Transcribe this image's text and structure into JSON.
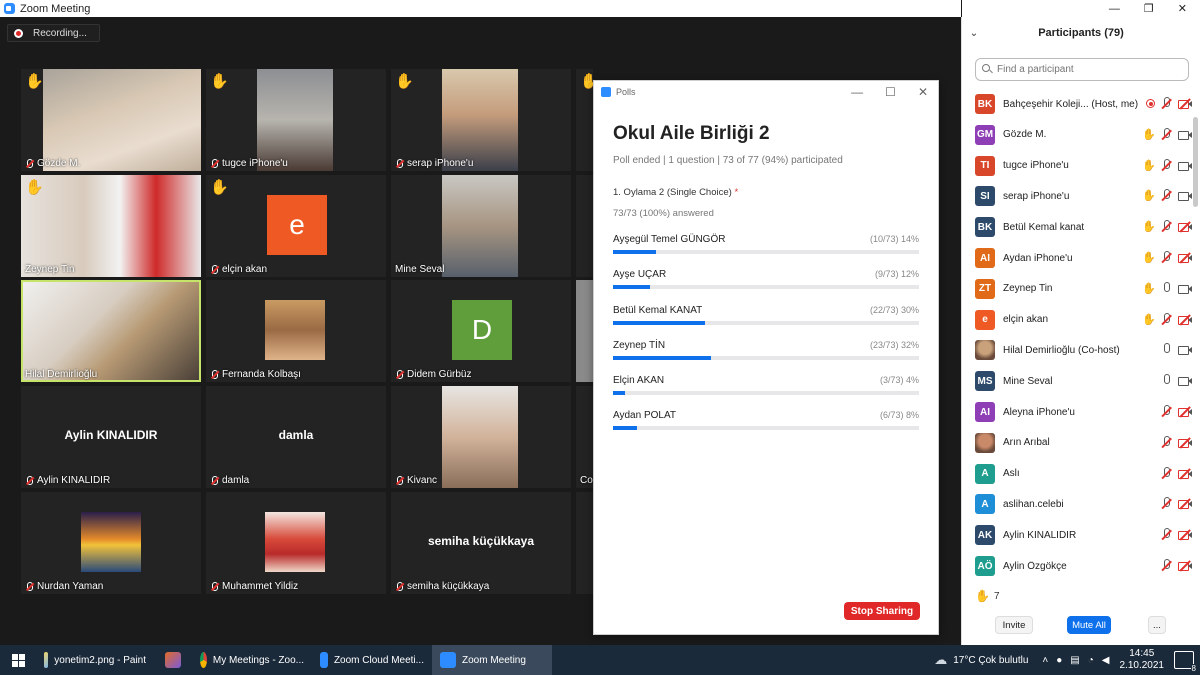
{
  "window": {
    "title": "Zoom Meeting"
  },
  "recording": {
    "label": "Recording..."
  },
  "tiles": [
    {
      "name": "Gözde M.",
      "hand": true
    },
    {
      "name": "tugce iPhone'u",
      "hand": true
    },
    {
      "name": "serap iPhone'u",
      "hand": true
    },
    {
      "name": "Zeynep Tin",
      "hand": true
    },
    {
      "name": "elçin akan",
      "hand": true,
      "avatar": "e"
    },
    {
      "name": "Mine Seval"
    },
    {
      "name": "Hilal Demirlioğlu"
    },
    {
      "name": "Fernanda Kolbaşı"
    },
    {
      "name": "Didem Gürbüz",
      "avatar": "D"
    },
    {
      "name": "Aylin KINALIDIR",
      "bigname": "Aylin KINALIDIR"
    },
    {
      "name": "damla",
      "bigname": "damla"
    },
    {
      "name": "Kivanc"
    },
    {
      "name": "Nurdan Yaman"
    },
    {
      "name": "Muhammet Yildiz"
    },
    {
      "name": "semiha küçükkaya",
      "bigname": "semiha küçükkaya"
    },
    {
      "name": "Cor"
    }
  ],
  "polls": {
    "window_title": "Polls",
    "title": "Okul Aile Birliği 2",
    "meta": "Poll ended  |  1 question  |  73 of 77 (94%) participated",
    "question": "1. Oylama 2 (Single Choice)",
    "required_mark": "*",
    "answered": "73/73 (100%) answered",
    "options": [
      {
        "label": "Ayşegül Temel GÜNGÖR",
        "stat": "(10/73) 14%",
        "percent": 14
      },
      {
        "label": "Ayşe UÇAR",
        "stat": "(9/73) 12%",
        "percent": 12
      },
      {
        "label": "Betül Kemal KANAT",
        "stat": "(22/73) 30%",
        "percent": 30
      },
      {
        "label": "Zeynep TİN",
        "stat": "(23/73) 32%",
        "percent": 32
      },
      {
        "label": "Elçin AKAN",
        "stat": "(3/73) 4%",
        "percent": 4
      },
      {
        "label": "Aydan POLAT",
        "stat": "(6/73) 8%",
        "percent": 8
      }
    ],
    "stop_sharing": "Stop Sharing"
  },
  "participants": {
    "header": "Participants (79)",
    "search_placeholder": "Find a participant",
    "list": [
      {
        "initials": "BK",
        "name": "Bahçeşehir Koleji... (Host, me)",
        "color": "#d9472b",
        "hand": false,
        "rec": true,
        "mic": "muted",
        "cam": "off"
      },
      {
        "initials": "GM",
        "name": "Gözde M.",
        "color": "#8e3fb5",
        "hand": true,
        "mic": "muted",
        "cam": "on"
      },
      {
        "initials": "TI",
        "name": "tugce iPhone'u",
        "color": "#d9472b",
        "hand": true,
        "mic": "muted",
        "cam": "on"
      },
      {
        "initials": "SI",
        "name": "serap iPhone'u",
        "color": "#2d4a6b",
        "hand": true,
        "mic": "muted",
        "cam": "on"
      },
      {
        "initials": "BK",
        "name": "Betül Kemal kanat",
        "color": "#2d4a6b",
        "hand": true,
        "mic": "muted",
        "cam": "off"
      },
      {
        "initials": "AI",
        "name": "Aydan iPhone'u",
        "color": "#e06a17",
        "hand": true,
        "mic": "muted",
        "cam": "off"
      },
      {
        "initials": "ZT",
        "name": "Zeynep Tin",
        "color": "#e06a17",
        "hand": true,
        "mic": "on",
        "cam": "on"
      },
      {
        "initials": "e",
        "name": "elçin akan",
        "color": "#ef5a24",
        "hand": true,
        "mic": "muted",
        "cam": "off"
      },
      {
        "initials": "",
        "name": "Hilal Demirlioğlu (Co-host)",
        "color": "#c9a27c",
        "photo": true,
        "mic": "on",
        "cam": "on"
      },
      {
        "initials": "MS",
        "name": "Mine Seval",
        "color": "#2d4a6b",
        "mic": "on",
        "cam": "on"
      },
      {
        "initials": "AI",
        "name": "Aleyna iPhone'u",
        "color": "#8e3fb5",
        "mic": "muted",
        "cam": "off"
      },
      {
        "initials": "",
        "name": "Arın Arıbal",
        "color": "#c98a6a",
        "photo": true,
        "mic": "muted",
        "cam": "off"
      },
      {
        "initials": "A",
        "name": "Aslı",
        "color": "#1f9e8f",
        "mic": "muted",
        "cam": "off"
      },
      {
        "initials": "A",
        "name": "aslihan.celebi",
        "color": "#1e8fd6",
        "mic": "muted",
        "cam": "off"
      },
      {
        "initials": "AK",
        "name": "Aylin KINALIDIR",
        "color": "#2d4a6b",
        "mic": "muted",
        "cam": "off"
      },
      {
        "initials": "AÖ",
        "name": "Aylin Özgökçe",
        "color": "#1f9e8f",
        "mic": "muted",
        "cam": "off"
      }
    ],
    "raised_hands": "7",
    "invite": "Invite",
    "mute_all": "Mute All",
    "more": "..."
  },
  "taskbar": {
    "items": [
      {
        "label": "yonetim2.png - Paint"
      },
      {
        "label": ""
      },
      {
        "label": "My Meetings - Zoo..."
      },
      {
        "label": "Zoom Cloud Meeti..."
      },
      {
        "label": "Zoom Meeting"
      }
    ],
    "weather": "17°C  Çok bulutlu",
    "time": "14:45",
    "date": "2.10.2021",
    "notifications": "8"
  }
}
